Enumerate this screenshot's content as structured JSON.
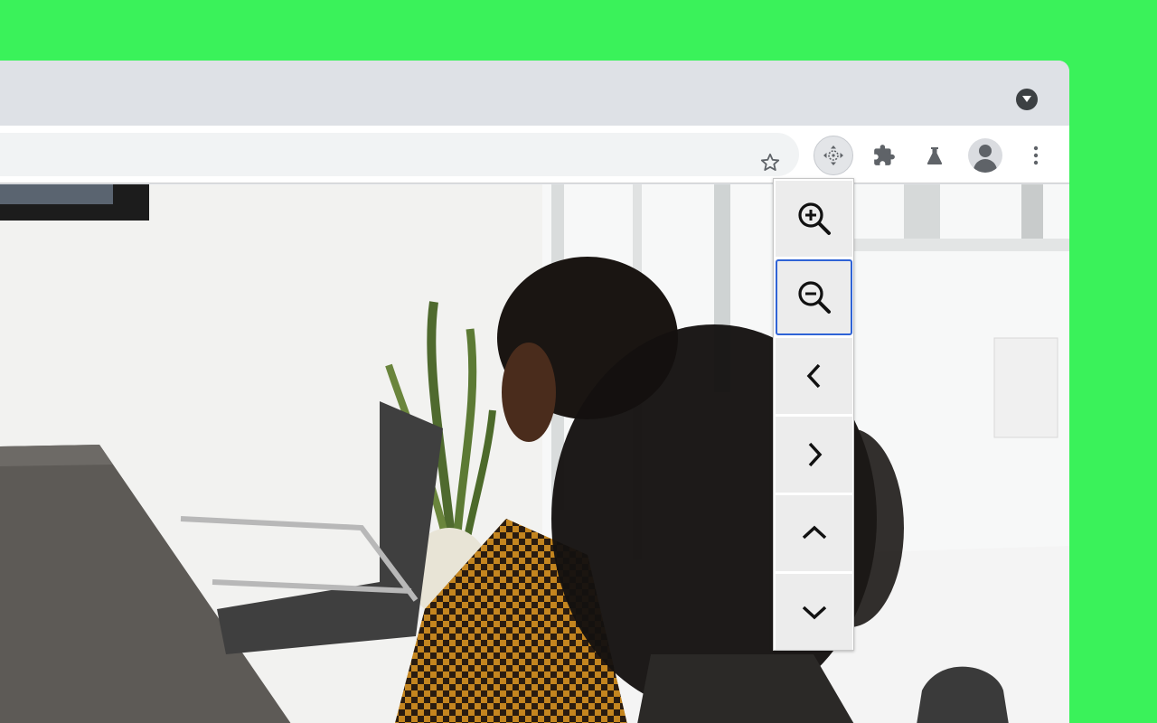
{
  "browser": {
    "tabstrip": {
      "dropdown_icon": "chevron-down-circle-icon"
    },
    "toolbar": {
      "bookmark_icon": "star-outline-icon",
      "extensions": [
        {
          "name": "move-extension",
          "icon": "move-arrows-icon"
        },
        {
          "name": "extensions",
          "icon": "puzzle-icon"
        },
        {
          "name": "labs",
          "icon": "flask-icon"
        }
      ],
      "profile_icon": "account-circle-icon",
      "menu_icon": "more-vert-icon"
    }
  },
  "zoom_panel": {
    "buttons": [
      {
        "id": "zoom-in",
        "icon": "zoom-in-icon",
        "active": false
      },
      {
        "id": "zoom-out",
        "icon": "zoom-out-icon",
        "active": true
      },
      {
        "id": "pan-left",
        "icon": "chevron-left-icon",
        "active": false
      },
      {
        "id": "pan-right",
        "icon": "chevron-right-icon",
        "active": false
      },
      {
        "id": "pan-up",
        "icon": "chevron-up-icon",
        "active": false
      },
      {
        "id": "pan-down",
        "icon": "chevron-down-icon",
        "active": false
      }
    ]
  },
  "colors": {
    "background": "#3af25a",
    "tabstrip": "#dee1e6",
    "omnibox": "#f1f3f4",
    "icon": "#5f6368",
    "focus_ring": "#2f63d6"
  }
}
